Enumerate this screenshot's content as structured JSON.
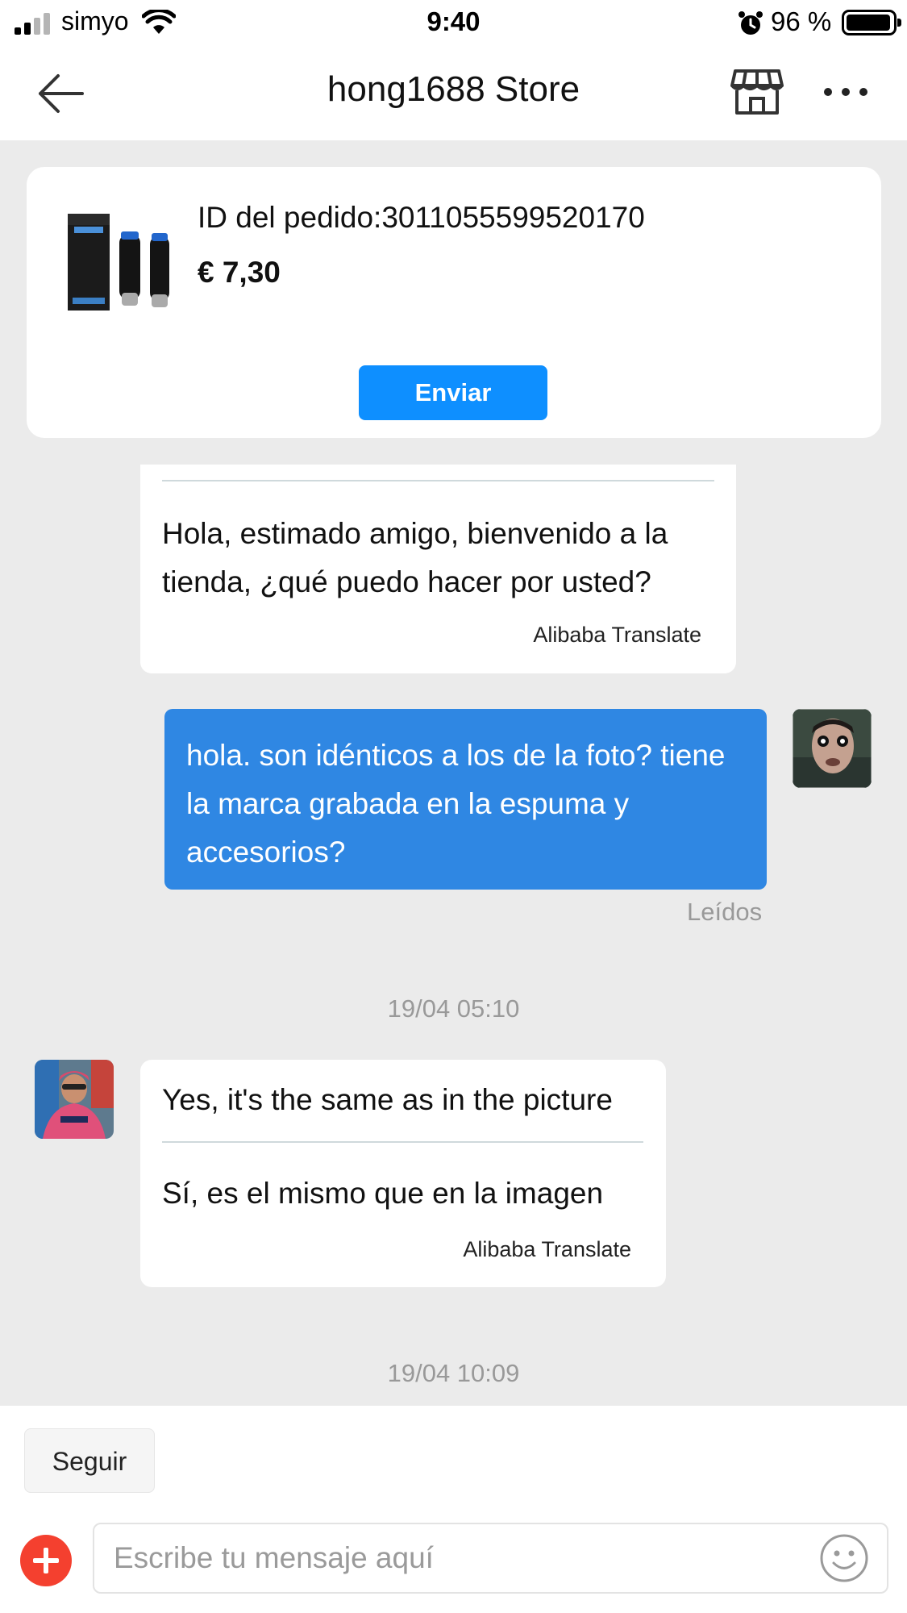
{
  "status_bar": {
    "carrier": "simyo",
    "time": "9:40",
    "battery_text": "96 %",
    "battery_level": 0.96,
    "icons": [
      "signal-icon",
      "wifi-icon",
      "alarm-icon",
      "battery-icon"
    ]
  },
  "nav": {
    "title": "hong1688 Store",
    "icons": [
      "back-arrow-icon",
      "store-icon",
      "more-icon"
    ]
  },
  "order": {
    "order_id": "ID del pedido:3011055599520170",
    "price": "€ 7,30",
    "send_label": "Enviar"
  },
  "messages": [
    {
      "direction": "incoming",
      "translated_text": "Hola, estimado amigo, bienvenido a la tienda, ¿qué puedo hacer por usted?",
      "credit": "Alibaba Translate"
    },
    {
      "direction": "outgoing",
      "text": "hola. son idénticos a los de la foto? tiene la marca grabada en la espuma y accesorios?",
      "status": "Leídos"
    },
    {
      "direction": "timestamp",
      "text": "19/04 05:10"
    },
    {
      "direction": "incoming",
      "original_text": "Yes, it's the same as in the picture",
      "translated_text": "Sí, es el mismo que en la imagen",
      "credit": "Alibaba Translate"
    },
    {
      "direction": "timestamp",
      "text": "19/04 10:09"
    }
  ],
  "bottom": {
    "follow_label": "Seguir",
    "input_placeholder": "Escribe tu mensaje aquí",
    "icons": [
      "add-icon",
      "emoji-icon"
    ]
  },
  "colors": {
    "accent_blue": "#0e8fff",
    "outgoing_bubble": "#2f87e3",
    "add_button": "#f4402f",
    "chat_background": "#ebebeb"
  }
}
